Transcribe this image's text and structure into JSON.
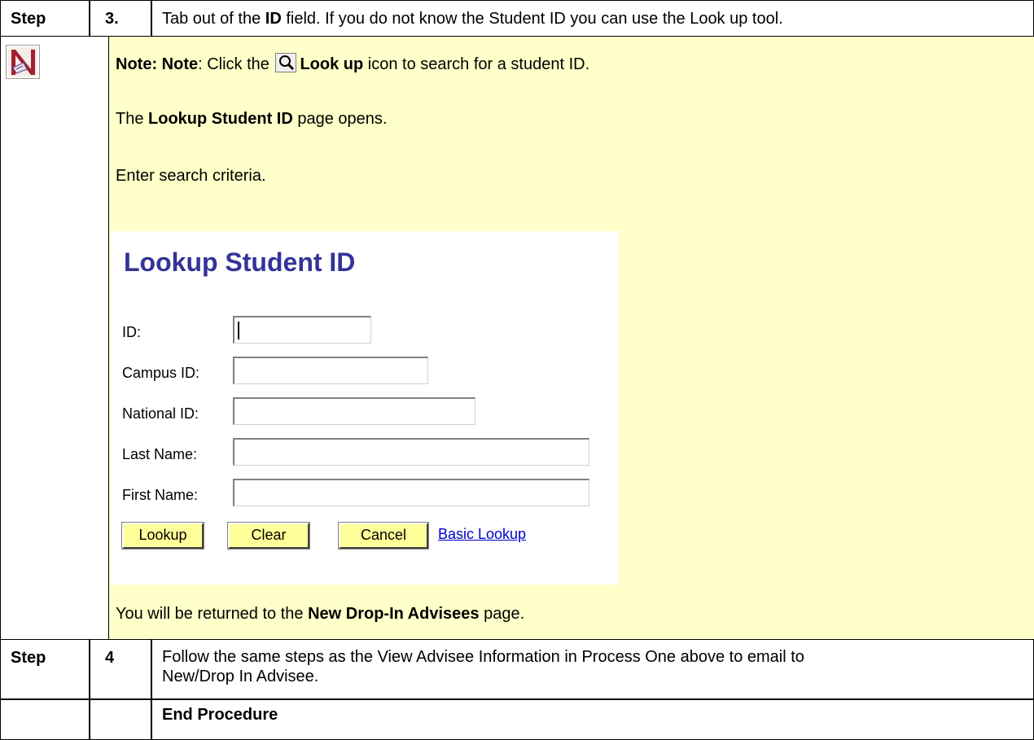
{
  "rows": [
    {
      "step": "Step",
      "number": "3.",
      "text_parts": [
        "Tab out of the ",
        "ID",
        " field.  If you do not know the Student ID you can use the Look up tool."
      ]
    },
    {
      "step": "Step",
      "number": "4",
      "text_line1": "Follow the same steps as the View Advisee Information in Process One above to email to",
      "text_line2": "New/Drop In Advisee."
    },
    {
      "step": "",
      "number": "",
      "text": "End Procedure"
    }
  ],
  "note": {
    "icon": "N",
    "line1_bold": "Note: Note",
    "line1_a": ": Click the ",
    "line1_icon": "magnifier-icon",
    "line1_bold2": "Look up",
    "line1_b": " icon to search for a student ID.",
    "line2_a": "The ",
    "line2_bold": "Lookup Student ID",
    "line2_b": " page opens.",
    "line3": "Enter search criteria.",
    "line4_a": "You will be returned to the ",
    "line4_bold": "New Drop-In Advisees",
    "line4_b": " page."
  },
  "lookup": {
    "title": "Lookup Student ID",
    "fields": [
      {
        "label": "ID:",
        "value": ""
      },
      {
        "label": "Campus ID:",
        "value": ""
      },
      {
        "label": "National ID:",
        "value": ""
      },
      {
        "label": "Last Name:",
        "value": ""
      },
      {
        "label": "First Name:",
        "value": ""
      }
    ],
    "buttons": {
      "lookup": "Lookup",
      "clear": "Clear",
      "cancel": "Cancel"
    },
    "basic_link": "Basic Lookup"
  },
  "colors": {
    "note_bg": "#ffffc9",
    "button_bg": "#ffff99",
    "title_color": "#333399",
    "link_color": "#0000cc"
  }
}
